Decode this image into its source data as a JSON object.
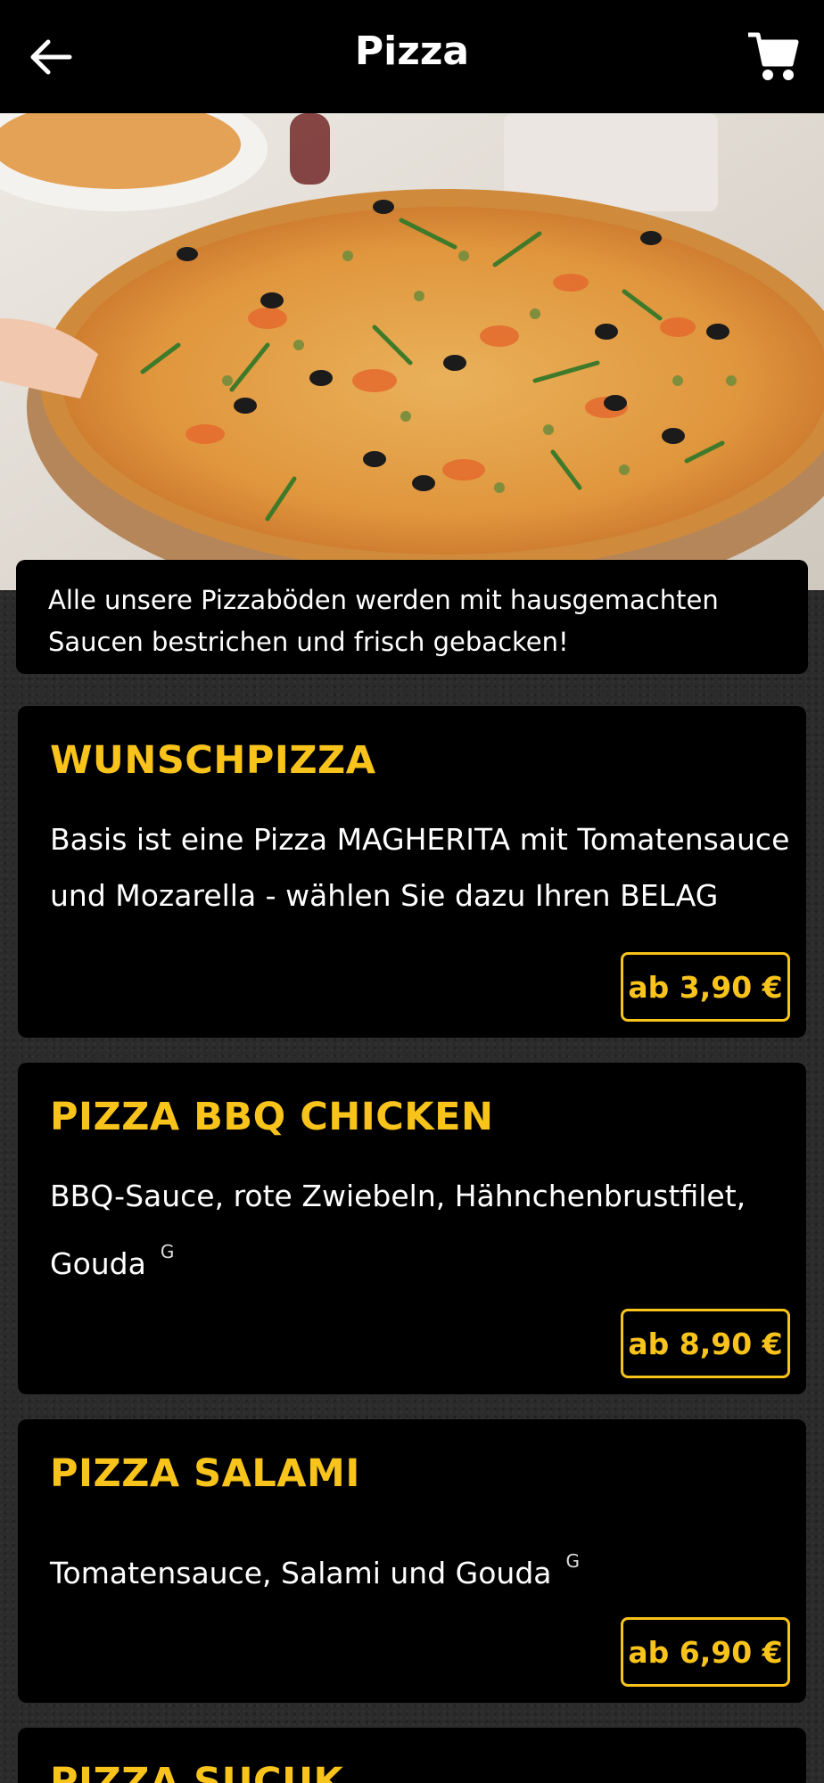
{
  "header": {
    "title": "Pizza",
    "back_icon": "arrow-left-icon",
    "cart_icon": "shopping-cart-icon"
  },
  "hero": {
    "image": "pizza-photo"
  },
  "intro": {
    "text": "Alle unsere Pizzaböden werden mit hausgemachten Saucen bestrichen und frisch gebacken!"
  },
  "products": [
    {
      "title": "WUNSCHPIZZA",
      "description": "Basis ist eine Pizza MAGHERITA mit Tomatensauce und Mozarella - wählen Sie dazu Ihren BELAG",
      "allergen": "",
      "price": "ab 3,90 €"
    },
    {
      "title": "PIZZA BBQ CHICKEN",
      "description": "BBQ-Sauce, rote Zwiebeln, Hähnchenbrustfilet, Gouda",
      "allergen": "G",
      "price": "ab 8,90 €"
    },
    {
      "title": "PIZZA SALAMI",
      "description": "Tomatensauce, Salami und Gouda",
      "allergen": "G",
      "price": "ab 6,90 €"
    },
    {
      "title": "PIZZA SUCUK"
    }
  ],
  "colors": {
    "accent": "#f8c31a",
    "header_bg": "#000000",
    "page_bg": "#2b2b2b"
  }
}
